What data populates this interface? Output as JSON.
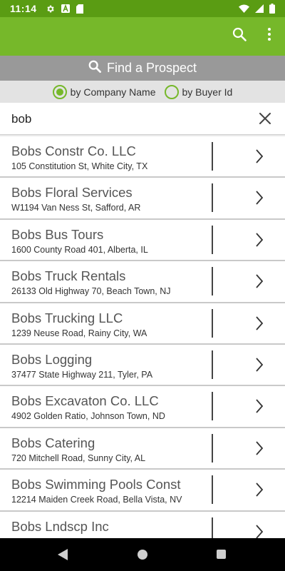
{
  "status_bar": {
    "time": "11:14",
    "left_icons": [
      "gear-icon",
      "a-icon",
      "sd-card-icon"
    ],
    "right_icons": [
      "wifi-icon",
      "signal-icon",
      "battery-icon"
    ]
  },
  "app_bar": {
    "actions": [
      "search-icon",
      "more-vert-icon"
    ],
    "color": "#76b82a"
  },
  "find_header": {
    "label": "Find a Prospect"
  },
  "search_mode": {
    "options": [
      {
        "label": "by Company Name",
        "selected": true
      },
      {
        "label": "by Buyer Id",
        "selected": false
      }
    ]
  },
  "search": {
    "value": "bob"
  },
  "results": [
    {
      "name": "Bobs Constr Co. LLC",
      "address": "105 Constitution St, White City, TX"
    },
    {
      "name": "Bobs Floral Services",
      "address": "W1194 Van Ness St, Safford, AR"
    },
    {
      "name": "Bobs Bus Tours",
      "address": "1600 County Road 401, Alberta, IL"
    },
    {
      "name": "Bobs Truck Rentals",
      "address": "26133 Old Highway 70, Beach Town, NJ"
    },
    {
      "name": "Bobs Trucking LLC",
      "address": "1239 Neuse Road, Rainy City, WA"
    },
    {
      "name": "Bobs Logging",
      "address": "37477 State Highway 211, Tyler, PA"
    },
    {
      "name": "Bobs Excavaton Co. LLC",
      "address": "4902 Golden Ratio, Johnson Town, ND"
    },
    {
      "name": "Bobs Catering",
      "address": "720 Mitchell Road, Sunny City, AL"
    },
    {
      "name": "Bobs Swimming Pools Const",
      "address": "12214 Maiden Creek Road, Bella Vista, NV"
    },
    {
      "name": "Bobs Lndscp Inc",
      "address": ""
    }
  ]
}
